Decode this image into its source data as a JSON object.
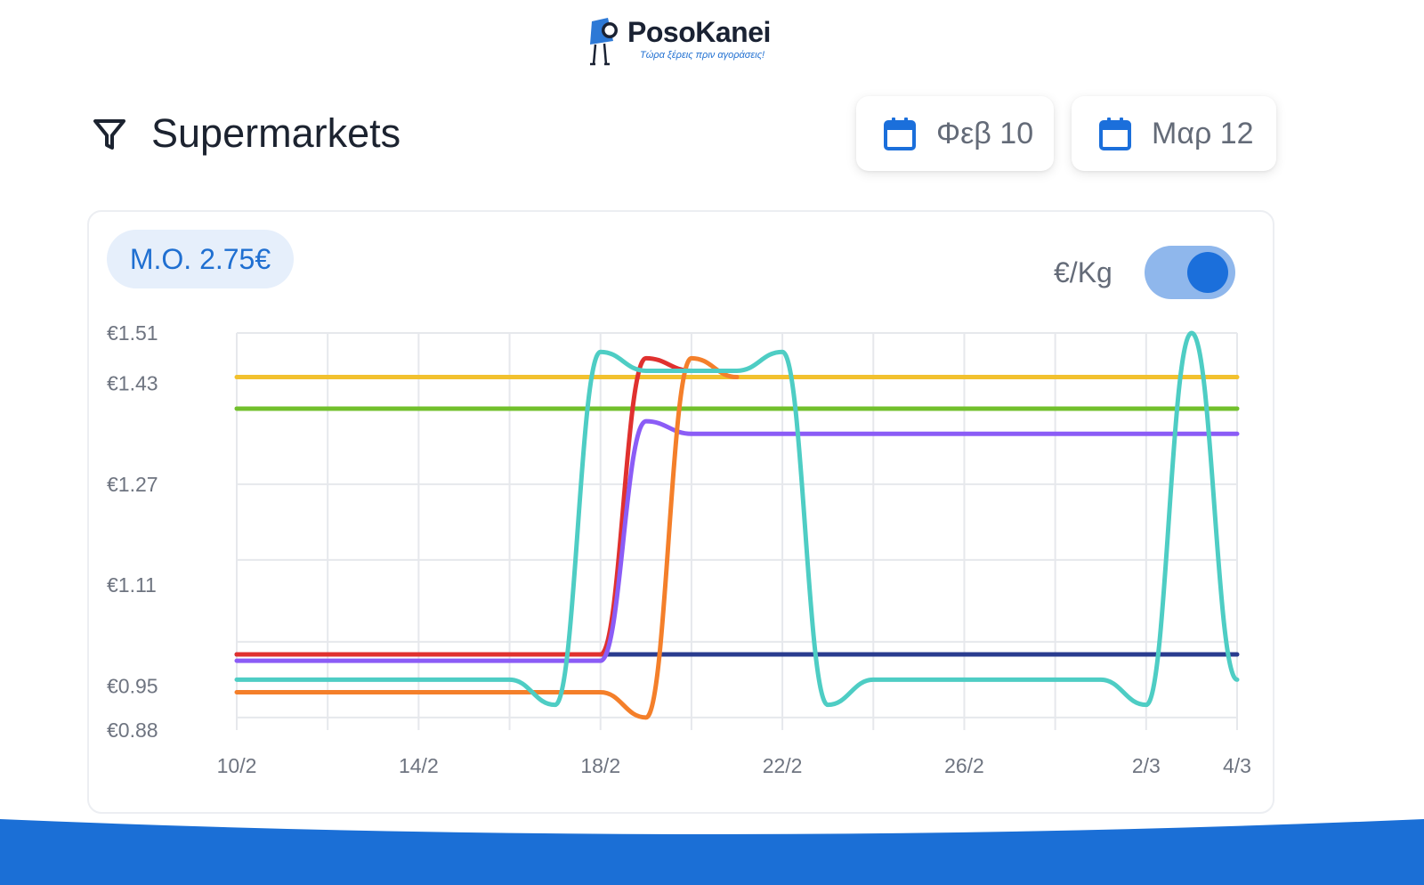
{
  "brand": {
    "name": "PosoKanei",
    "tagline": "Τώρα ξέρεις πριν αγοράσεις!",
    "logo_icon": "mascot-magnifier-icon",
    "color": "#1f6fd1"
  },
  "header": {
    "filter_icon": "filter-funnel-icon",
    "title": "Supermarkets",
    "date_from": "Φεβ 10",
    "date_to": "Μαρ 12",
    "calendar_icon": "calendar-icon",
    "calendar_color": "#1b6fdb"
  },
  "card": {
    "average_badge": "Μ.Ο. 2.75€",
    "unit_label": "€/Kg",
    "unit_toggle_on": true,
    "toggle_track_color": "#8fb7ec",
    "toggle_knob_color": "#1b6fdb"
  },
  "chart_data": {
    "type": "line",
    "title": "",
    "xlabel": "",
    "ylabel": "",
    "x": [
      "10/2",
      "11/2",
      "12/2",
      "13/2",
      "14/2",
      "15/2",
      "16/2",
      "17/2",
      "18/2",
      "19/2",
      "20/2",
      "21/2",
      "22/2",
      "23/2",
      "24/2",
      "25/2",
      "26/2",
      "27/2",
      "28/2",
      "1/3",
      "2/3",
      "3/3",
      "4/3"
    ],
    "x_tick_labels": [
      "10/2",
      "14/2",
      "18/2",
      "22/2",
      "26/2",
      "2/3",
      "4/3"
    ],
    "y_tick_labels": [
      "€1.51",
      "€1.43",
      "€1.27",
      "€1.11",
      "€0.95",
      "€0.88"
    ],
    "y_ticks": [
      1.51,
      1.43,
      1.27,
      1.11,
      0.95,
      0.88
    ],
    "ylim": [
      0.88,
      1.51
    ],
    "grid": true,
    "legend": "none",
    "series": [
      {
        "color": "#f2c12e",
        "values": [
          1.44,
          1.44,
          1.44,
          1.44,
          1.44,
          1.44,
          1.44,
          1.44,
          1.44,
          1.44,
          1.44,
          1.44,
          1.44,
          1.44,
          1.44,
          1.44,
          1.44,
          1.44,
          1.44,
          1.44,
          1.44,
          1.44,
          1.44
        ]
      },
      {
        "color": "#72c02c",
        "values": [
          1.39,
          1.39,
          1.39,
          1.39,
          1.39,
          1.39,
          1.39,
          1.39,
          1.39,
          1.39,
          1.39,
          1.39,
          1.39,
          1.39,
          1.39,
          1.39,
          1.39,
          1.39,
          1.39,
          1.39,
          1.39,
          1.39,
          1.39
        ]
      },
      {
        "color": "#2a3c8f",
        "values": [
          1.0,
          1.0,
          1.0,
          1.0,
          1.0,
          1.0,
          1.0,
          1.0,
          1.0,
          1.0,
          1.0,
          1.0,
          1.0,
          1.0,
          1.0,
          1.0,
          1.0,
          1.0,
          1.0,
          1.0,
          1.0,
          1.0,
          1.0
        ]
      },
      {
        "color": "#e0312f",
        "values": [
          1.0,
          1.0,
          1.0,
          1.0,
          1.0,
          1.0,
          1.0,
          1.0,
          1.0,
          1.47,
          1.45
        ]
      },
      {
        "color": "#8b5cf6",
        "values": [
          0.99,
          0.99,
          0.99,
          0.99,
          0.99,
          0.99,
          0.99,
          0.99,
          0.99,
          1.37,
          1.35,
          1.35,
          1.35,
          1.35,
          1.35,
          1.35,
          1.35,
          1.35,
          1.35,
          1.35,
          1.35,
          1.35,
          1.35
        ]
      },
      {
        "color": "#f47f2a",
        "values": [
          0.94,
          0.94,
          0.94,
          0.94,
          0.94,
          0.94,
          0.94,
          0.94,
          0.94,
          0.9,
          1.47,
          1.44
        ]
      },
      {
        "color": "#4ecdc4",
        "values": [
          0.96,
          0.96,
          0.96,
          0.96,
          0.96,
          0.96,
          0.96,
          0.92,
          1.48,
          1.45,
          1.45,
          1.45,
          1.48,
          0.92,
          0.96,
          0.96,
          0.96,
          0.96,
          0.96,
          0.96,
          0.92,
          1.51,
          0.96
        ]
      }
    ]
  },
  "footer": {
    "band_color": "#1b6fd6"
  }
}
